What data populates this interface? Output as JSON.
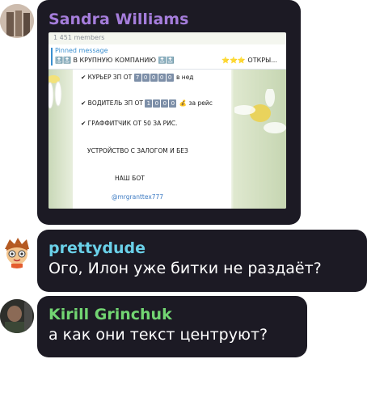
{
  "messages": [
    {
      "author": "Sandra Williams",
      "author_color": "#a57ddb",
      "embedded": {
        "members": "1 451 members",
        "pinned_label": "Pinned message",
        "pinned_text": "🔝🔝 В КРУПНУЮ КОМПАНИЮ 🔝🔝",
        "pinned_text_right": "⭐⭐⭐ ОТКРЫ...",
        "lines": {
          "courier_prefix": "✔ КУРЬЕР ЗП ОТ",
          "courier_digits": [
            "7",
            "0",
            "0",
            "0",
            "0"
          ],
          "courier_suffix": "в нед",
          "driver_prefix": "✔ ВОДИТЕЛЬ ЗП ОТ",
          "driver_digits": [
            "1",
            "0",
            "0",
            "0"
          ],
          "driver_suffix": "💰 за рейс",
          "designer": "✔ ГРАФФИТЧИК ОТ 50 ЗА РИС.",
          "deposit": "УСТРОЙСТВО С ЗАЛОГОМ И БЕЗ",
          "bot": "НАШ БОТ",
          "handle": "@mrgranttex777"
        }
      }
    },
    {
      "author": "prettydude",
      "author_color": "#6ad0e8",
      "text": "Ого, Илон уже битки не раздаёт?"
    },
    {
      "author": "Kirill Grinchuk",
      "author_color": "#72d572",
      "text": "а как они текст центруют?"
    }
  ]
}
